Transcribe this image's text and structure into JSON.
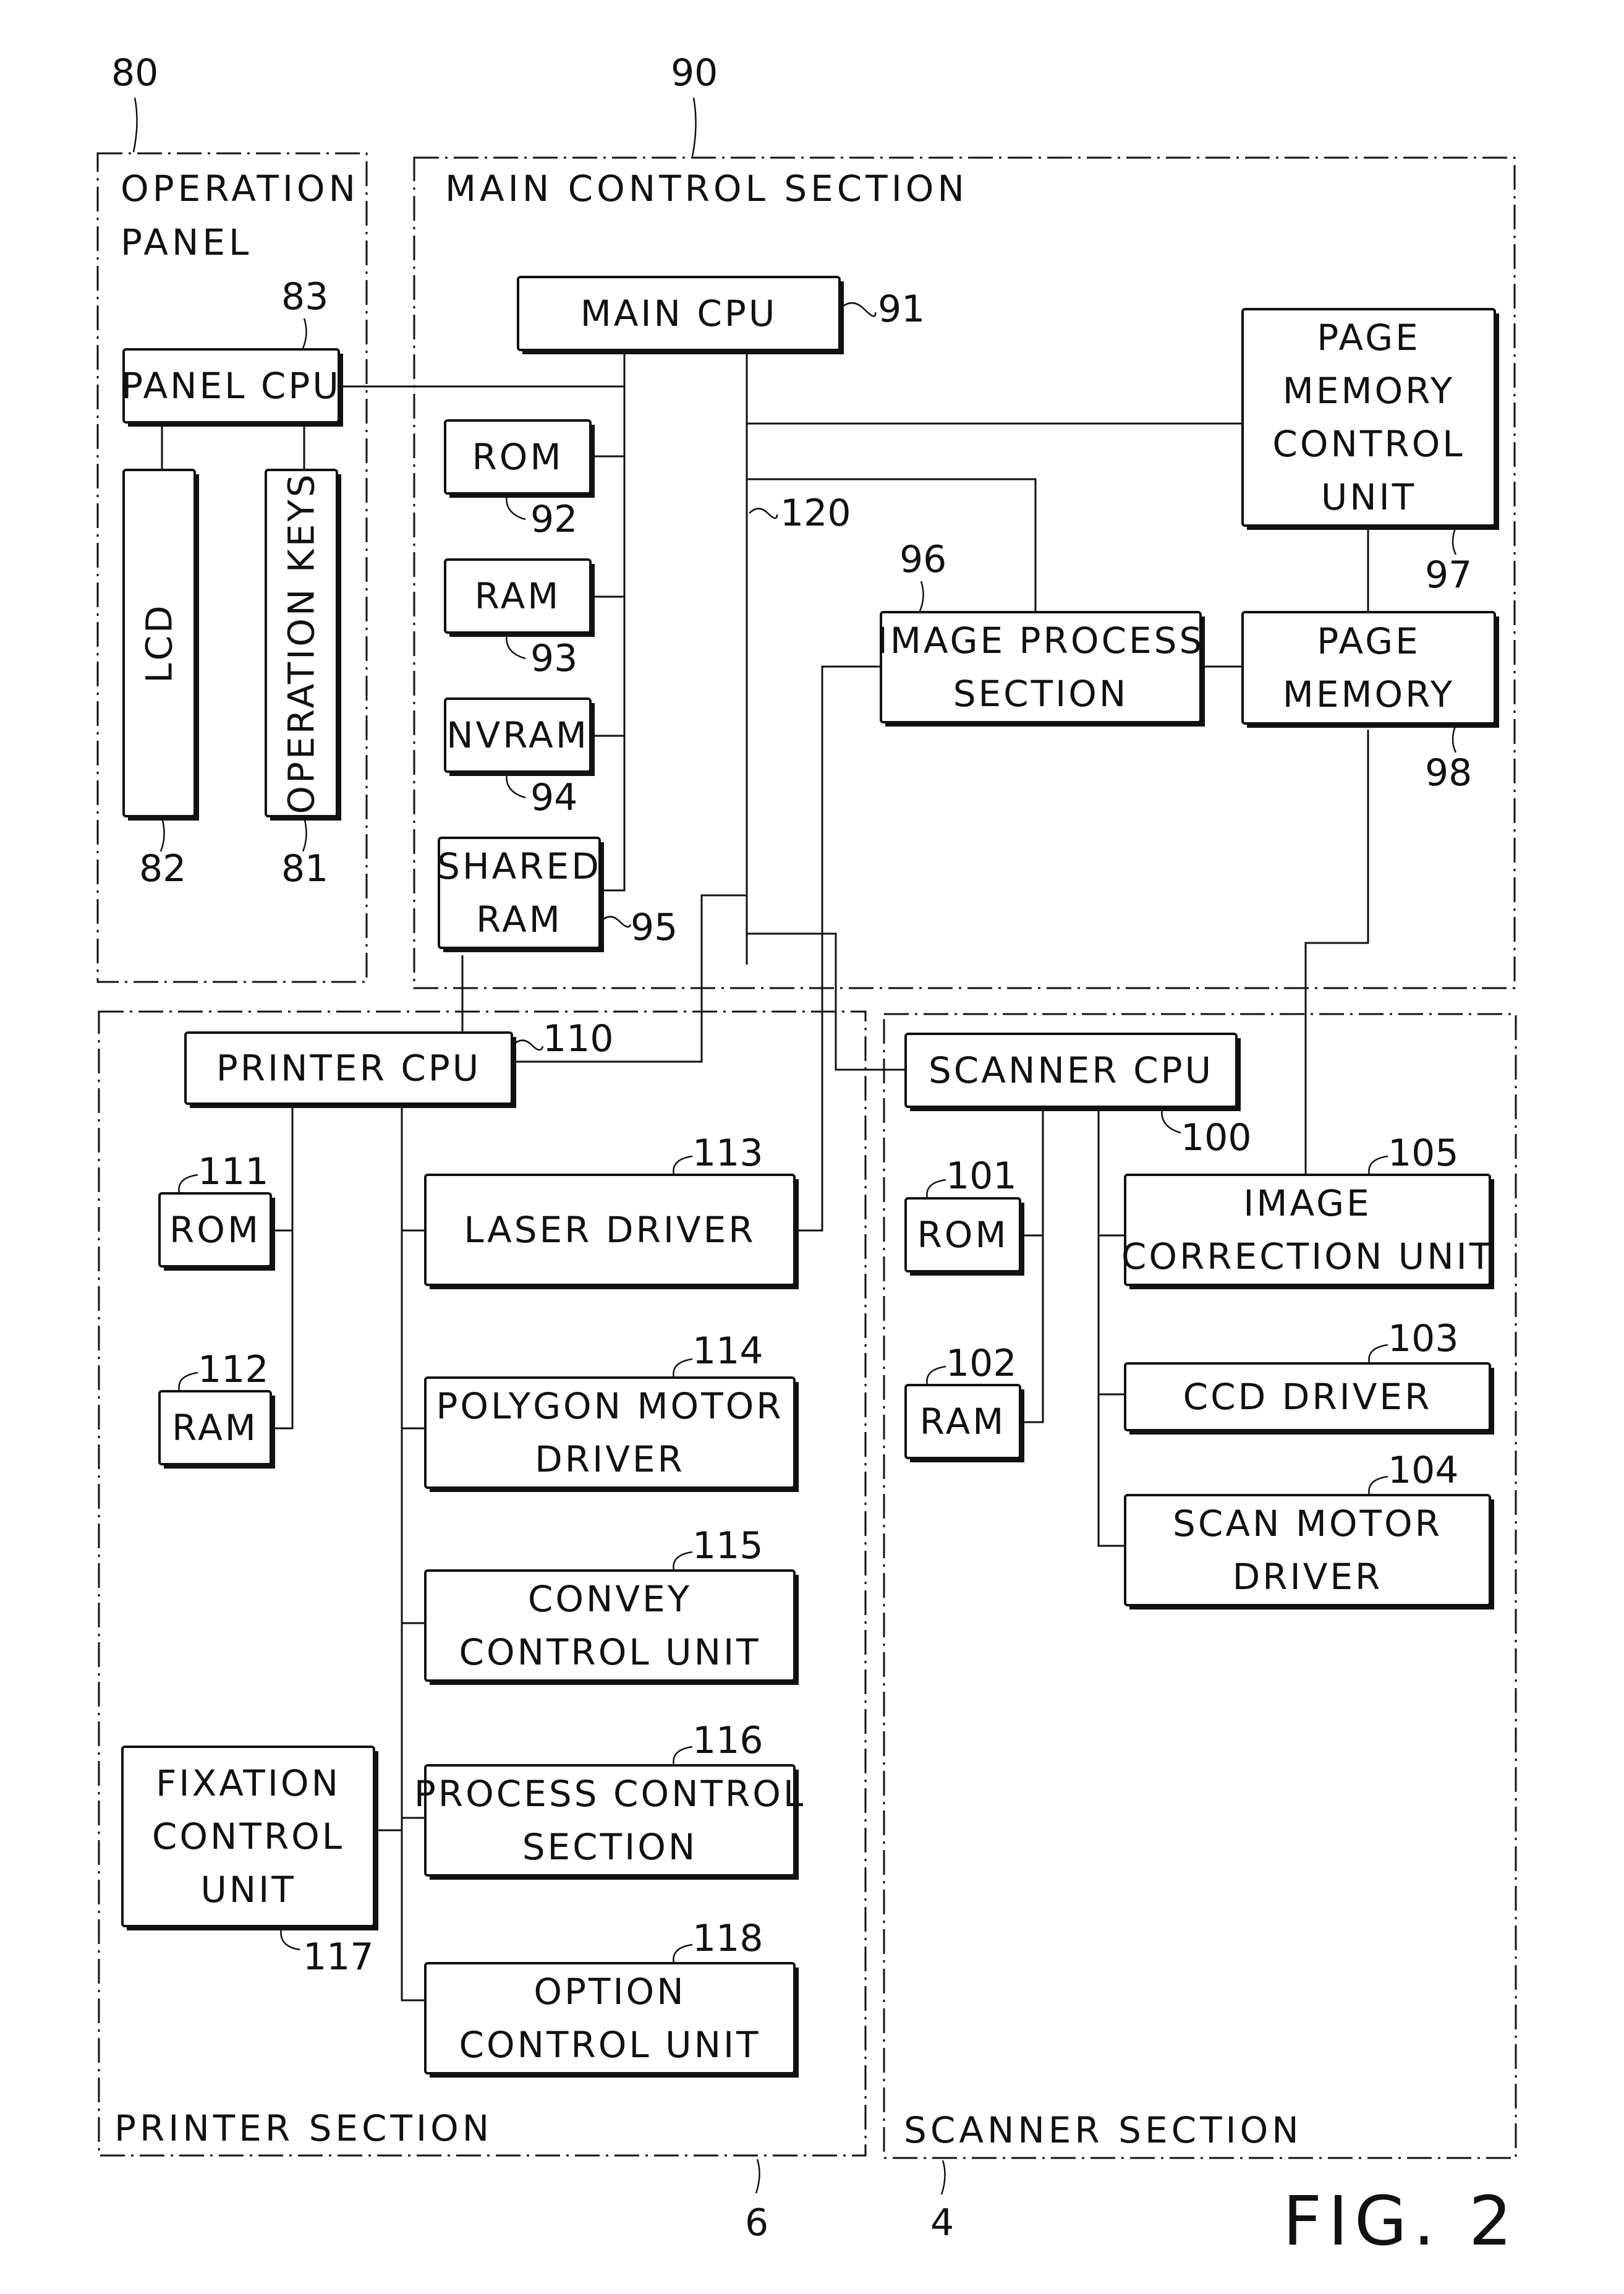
{
  "figure": {
    "label": "FIG. 2"
  },
  "sections": {
    "operation_panel": {
      "ref": "80",
      "title_lines": [
        "OPERATION",
        "PANEL"
      ]
    },
    "main_control": {
      "ref": "90",
      "title": "MAIN CONTROL SECTION"
    },
    "printer": {
      "ref": "6",
      "title": "PRINTER SECTION"
    },
    "scanner": {
      "ref": "4",
      "title": "SCANNER SECTION"
    }
  },
  "blocks": {
    "panel_cpu": {
      "ref": "83",
      "lines": [
        "PANEL CPU"
      ]
    },
    "lcd": {
      "ref": "82",
      "lines": [
        "LCD"
      ]
    },
    "operation_keys": {
      "ref": "81",
      "lines": [
        "OPERATION KEYS"
      ]
    },
    "main_cpu": {
      "ref": "91",
      "lines": [
        "MAIN CPU"
      ]
    },
    "rom_main": {
      "ref": "92",
      "lines": [
        "ROM"
      ]
    },
    "ram_main": {
      "ref": "93",
      "lines": [
        "RAM"
      ]
    },
    "nvram": {
      "ref": "94",
      "lines": [
        "NVRAM"
      ]
    },
    "shared_ram": {
      "ref": "95",
      "lines": [
        "SHARED",
        "RAM"
      ]
    },
    "image_process": {
      "ref": "96",
      "lines": [
        "IMAGE PROCESS",
        "SECTION"
      ]
    },
    "page_memory_control": {
      "ref": "97",
      "lines": [
        "PAGE",
        "MEMORY",
        "CONTROL",
        "UNIT"
      ]
    },
    "page_memory": {
      "ref": "98",
      "lines": [
        "PAGE",
        "MEMORY"
      ]
    },
    "bus": {
      "ref": "120"
    },
    "printer_cpu": {
      "ref": "110",
      "lines": [
        "PRINTER CPU"
      ]
    },
    "rom_printer": {
      "ref": "111",
      "lines": [
        "ROM"
      ]
    },
    "ram_printer": {
      "ref": "112",
      "lines": [
        "RAM"
      ]
    },
    "laser_driver": {
      "ref": "113",
      "lines": [
        "LASER DRIVER"
      ]
    },
    "polygon_motor_driver": {
      "ref": "114",
      "lines": [
        "POLYGON MOTOR",
        "DRIVER"
      ]
    },
    "convey_control": {
      "ref": "115",
      "lines": [
        "CONVEY",
        "CONTROL UNIT"
      ]
    },
    "process_control": {
      "ref": "116",
      "lines": [
        "PROCESS CONTROL",
        "SECTION"
      ]
    },
    "fixation_control": {
      "ref": "117",
      "lines": [
        "FIXATION",
        "CONTROL",
        "UNIT"
      ]
    },
    "option_control": {
      "ref": "118",
      "lines": [
        "OPTION",
        "CONTROL UNIT"
      ]
    },
    "scanner_cpu": {
      "ref": "100",
      "lines": [
        "SCANNER CPU"
      ]
    },
    "rom_scanner": {
      "ref": "101",
      "lines": [
        "ROM"
      ]
    },
    "ram_scanner": {
      "ref": "102",
      "lines": [
        "RAM"
      ]
    },
    "image_correction": {
      "ref": "105",
      "lines": [
        "IMAGE",
        "CORRECTION UNIT"
      ]
    },
    "ccd_driver": {
      "ref": "103",
      "lines": [
        "CCD DRIVER"
      ]
    },
    "scan_motor_driver": {
      "ref": "104",
      "lines": [
        "SCAN MOTOR",
        "DRIVER"
      ]
    }
  }
}
